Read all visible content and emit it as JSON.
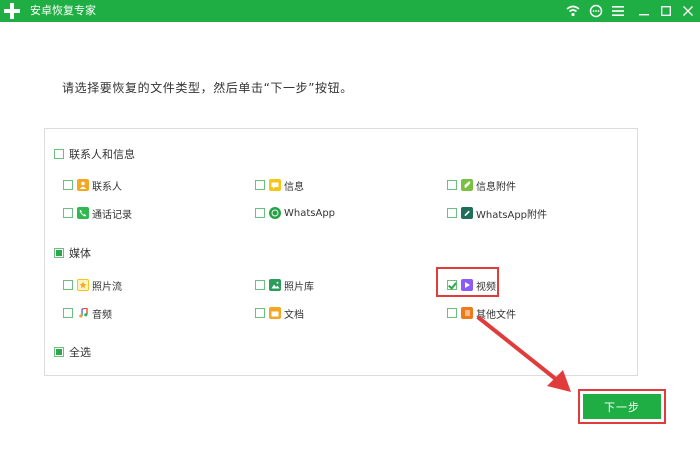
{
  "window": {
    "title": "安卓恢复专家",
    "controls": [
      "wifi-icon",
      "chat-icon",
      "menu-icon",
      "minimize-icon",
      "maximize-icon",
      "close-icon"
    ]
  },
  "instruction": "请选择要恢复的文件类型，然后单击“下一步”按钮。",
  "groups": {
    "contacts": {
      "label": "联系人和信息",
      "items": [
        {
          "label": "联系人",
          "icon": "contact-icon",
          "color": "#f5a623"
        },
        {
          "label": "信息",
          "icon": "message-icon",
          "color": "#f5c518"
        },
        {
          "label": "信息附件",
          "icon": "attachment-icon",
          "color": "#7ac143"
        },
        {
          "label": "通话记录",
          "icon": "phone-icon",
          "color": "#2fb84f"
        },
        {
          "label": "WhatsApp",
          "icon": "whatsapp-icon",
          "color": "#25a244"
        },
        {
          "label": "WhatsApp附件",
          "icon": "whatsapp-attachment-icon",
          "color": "#1e6e5a"
        }
      ]
    },
    "media": {
      "label": "媒体",
      "items": [
        {
          "label": "照片流",
          "icon": "photostream-icon",
          "color": "#f5c518"
        },
        {
          "label": "照片库",
          "icon": "photo-library-icon",
          "color": "#2a9d5a"
        },
        {
          "label": "视频",
          "icon": "video-icon",
          "color": "#8a5cf5",
          "checked": true
        },
        {
          "label": "音频",
          "icon": "audio-icon",
          "color": "#e84a3c"
        },
        {
          "label": "文档",
          "icon": "document-icon",
          "color": "#f5a623"
        },
        {
          "label": "其他文件",
          "icon": "other-files-icon",
          "color": "#f07a1a"
        }
      ]
    }
  },
  "select_all": "全选",
  "next_button": "下一步",
  "colors": {
    "brand": "#1fae43",
    "annotation": "#e03c3c"
  }
}
